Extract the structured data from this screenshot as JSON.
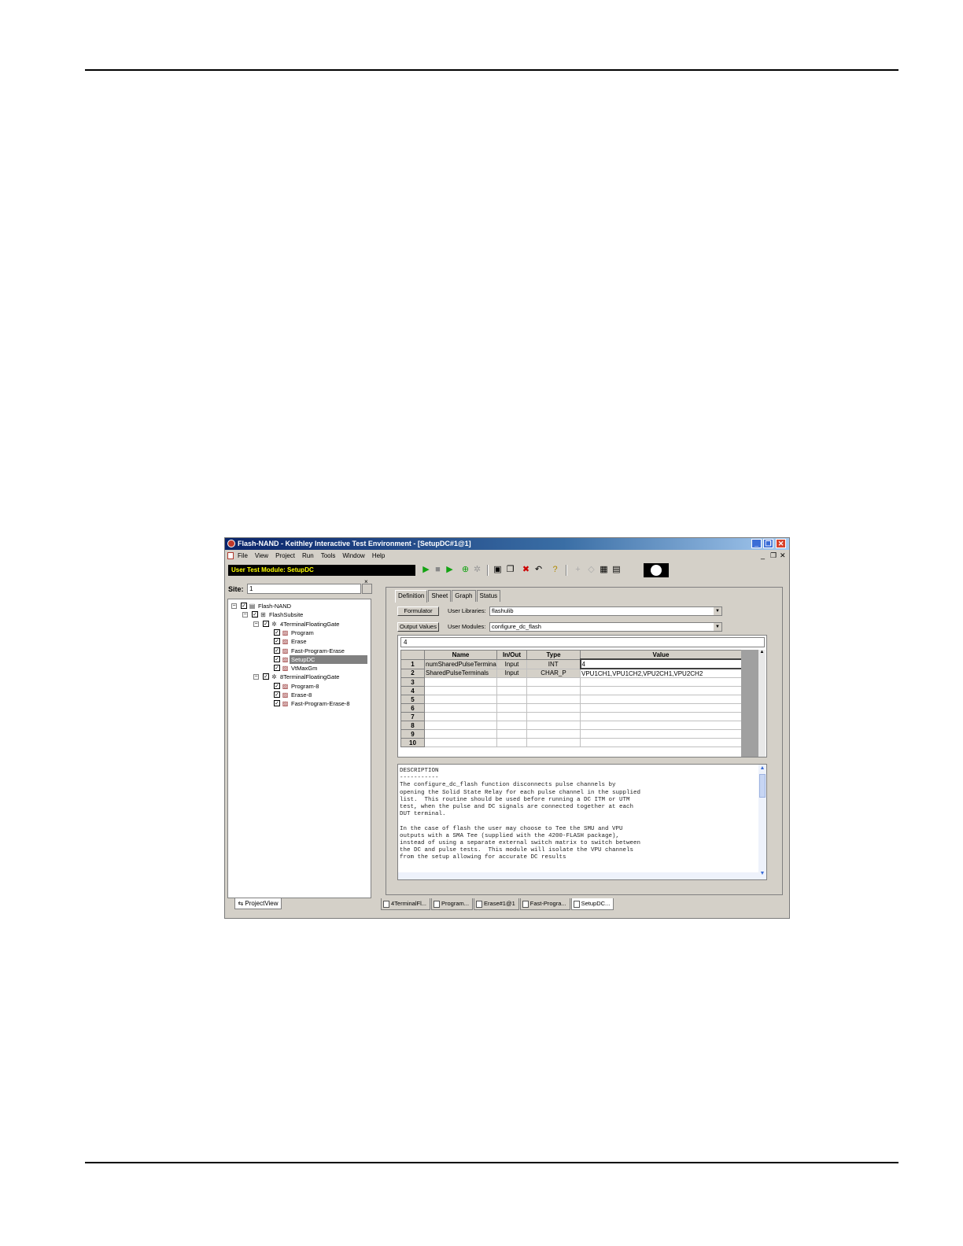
{
  "window": {
    "title": "Flash-NAND - Keithley Interactive Test Environment - [SetupDC#1@1]",
    "controls": [
      "_",
      "❐",
      "✕"
    ]
  },
  "menu": {
    "items": [
      "File",
      "View",
      "Project",
      "Run",
      "Tools",
      "Window",
      "Help"
    ],
    "mdi_controls": [
      "_",
      "❐",
      "✕"
    ]
  },
  "toolbar": {
    "module_label": "User Test Module: SetupDC",
    "icons": [
      "run-icon",
      "stop-icon",
      "run-step-icon",
      "append-icon",
      "project-run-icon",
      "save-icon",
      "save-all-icon",
      "delete-icon",
      "undo-icon",
      "help-icon",
      "plus-icon",
      "diamond-icon",
      "graph-icon",
      "doc-icon",
      "kite-icon"
    ]
  },
  "left_pane": {
    "site_label": "Site:",
    "site_value": "1",
    "tree": [
      {
        "label": "Flash-NAND",
        "level": 0
      },
      {
        "label": "FlashSubsite",
        "level": 1
      },
      {
        "label": "4TerminalFloatingGate",
        "level": 2
      },
      {
        "label": "Program",
        "level": 3
      },
      {
        "label": "Erase",
        "level": 3
      },
      {
        "label": "Fast-Program-Erase",
        "level": 3
      },
      {
        "label": "SetupDC",
        "level": 3,
        "selected": true
      },
      {
        "label": "VtMaxGm",
        "level": 3
      },
      {
        "label": "8TerminalFloatingGate",
        "level": 2
      },
      {
        "label": "Program-8",
        "level": 3
      },
      {
        "label": "Erase-8",
        "level": 3
      },
      {
        "label": "Fast-Program-Erase-8",
        "level": 3
      }
    ],
    "bottom_tab": "ProjectView"
  },
  "right_pane": {
    "tabs": [
      "Definition",
      "Sheet",
      "Graph",
      "Status"
    ],
    "active_tab": "Definition",
    "formulator_button": "Formulator",
    "output_values_button": "Output Values",
    "user_libraries_label": "User Libraries:",
    "user_libraries_value": "flashulib",
    "user_modules_label": "User Modules:",
    "user_modules_value": "configure_dc_flash",
    "edit_value": "4",
    "grid": {
      "headers": [
        "Name",
        "In/Out",
        "Type",
        "Value"
      ],
      "rows": [
        {
          "num": "1",
          "name": "numSharedPulseTerminals",
          "inout": "Input",
          "type": "INT",
          "value": "4"
        },
        {
          "num": "2",
          "name": "SharedPulseTerminals",
          "inout": "Input",
          "type": "CHAR_P",
          "value": "VPU1CH1,VPU1CH2,VPU2CH1,VPU2CH2"
        },
        {
          "num": "3"
        },
        {
          "num": "4"
        },
        {
          "num": "5"
        },
        {
          "num": "6"
        },
        {
          "num": "7"
        },
        {
          "num": "8"
        },
        {
          "num": "9"
        },
        {
          "num": "10"
        }
      ]
    },
    "description": "DESCRIPTION\n-----------\nThe configure_dc_flash function disconnects pulse channels by\nopening the Solid State Relay for each pulse channel in the supplied\nlist.  This routine should be used before running a DC ITM or UTM\ntest, when the pulse and DC signals are connected together at each\nDUT terminal.\n\nIn the case of flash the user may choose to Tee the SMU and VPU\noutputs with a SMA Tee (supplied with the 4200-FLASH package),\ninstead of using a separate external switch matrix to switch between\nthe DC and pulse tests.  This module will isolate the VPU channels\nfrom the setup allowing for accurate DC results",
    "doc_tabs": [
      "4TerminalFl...",
      "Program...",
      "Erase#1@1",
      "Fast-Progra...",
      "SetupDC..."
    ]
  }
}
